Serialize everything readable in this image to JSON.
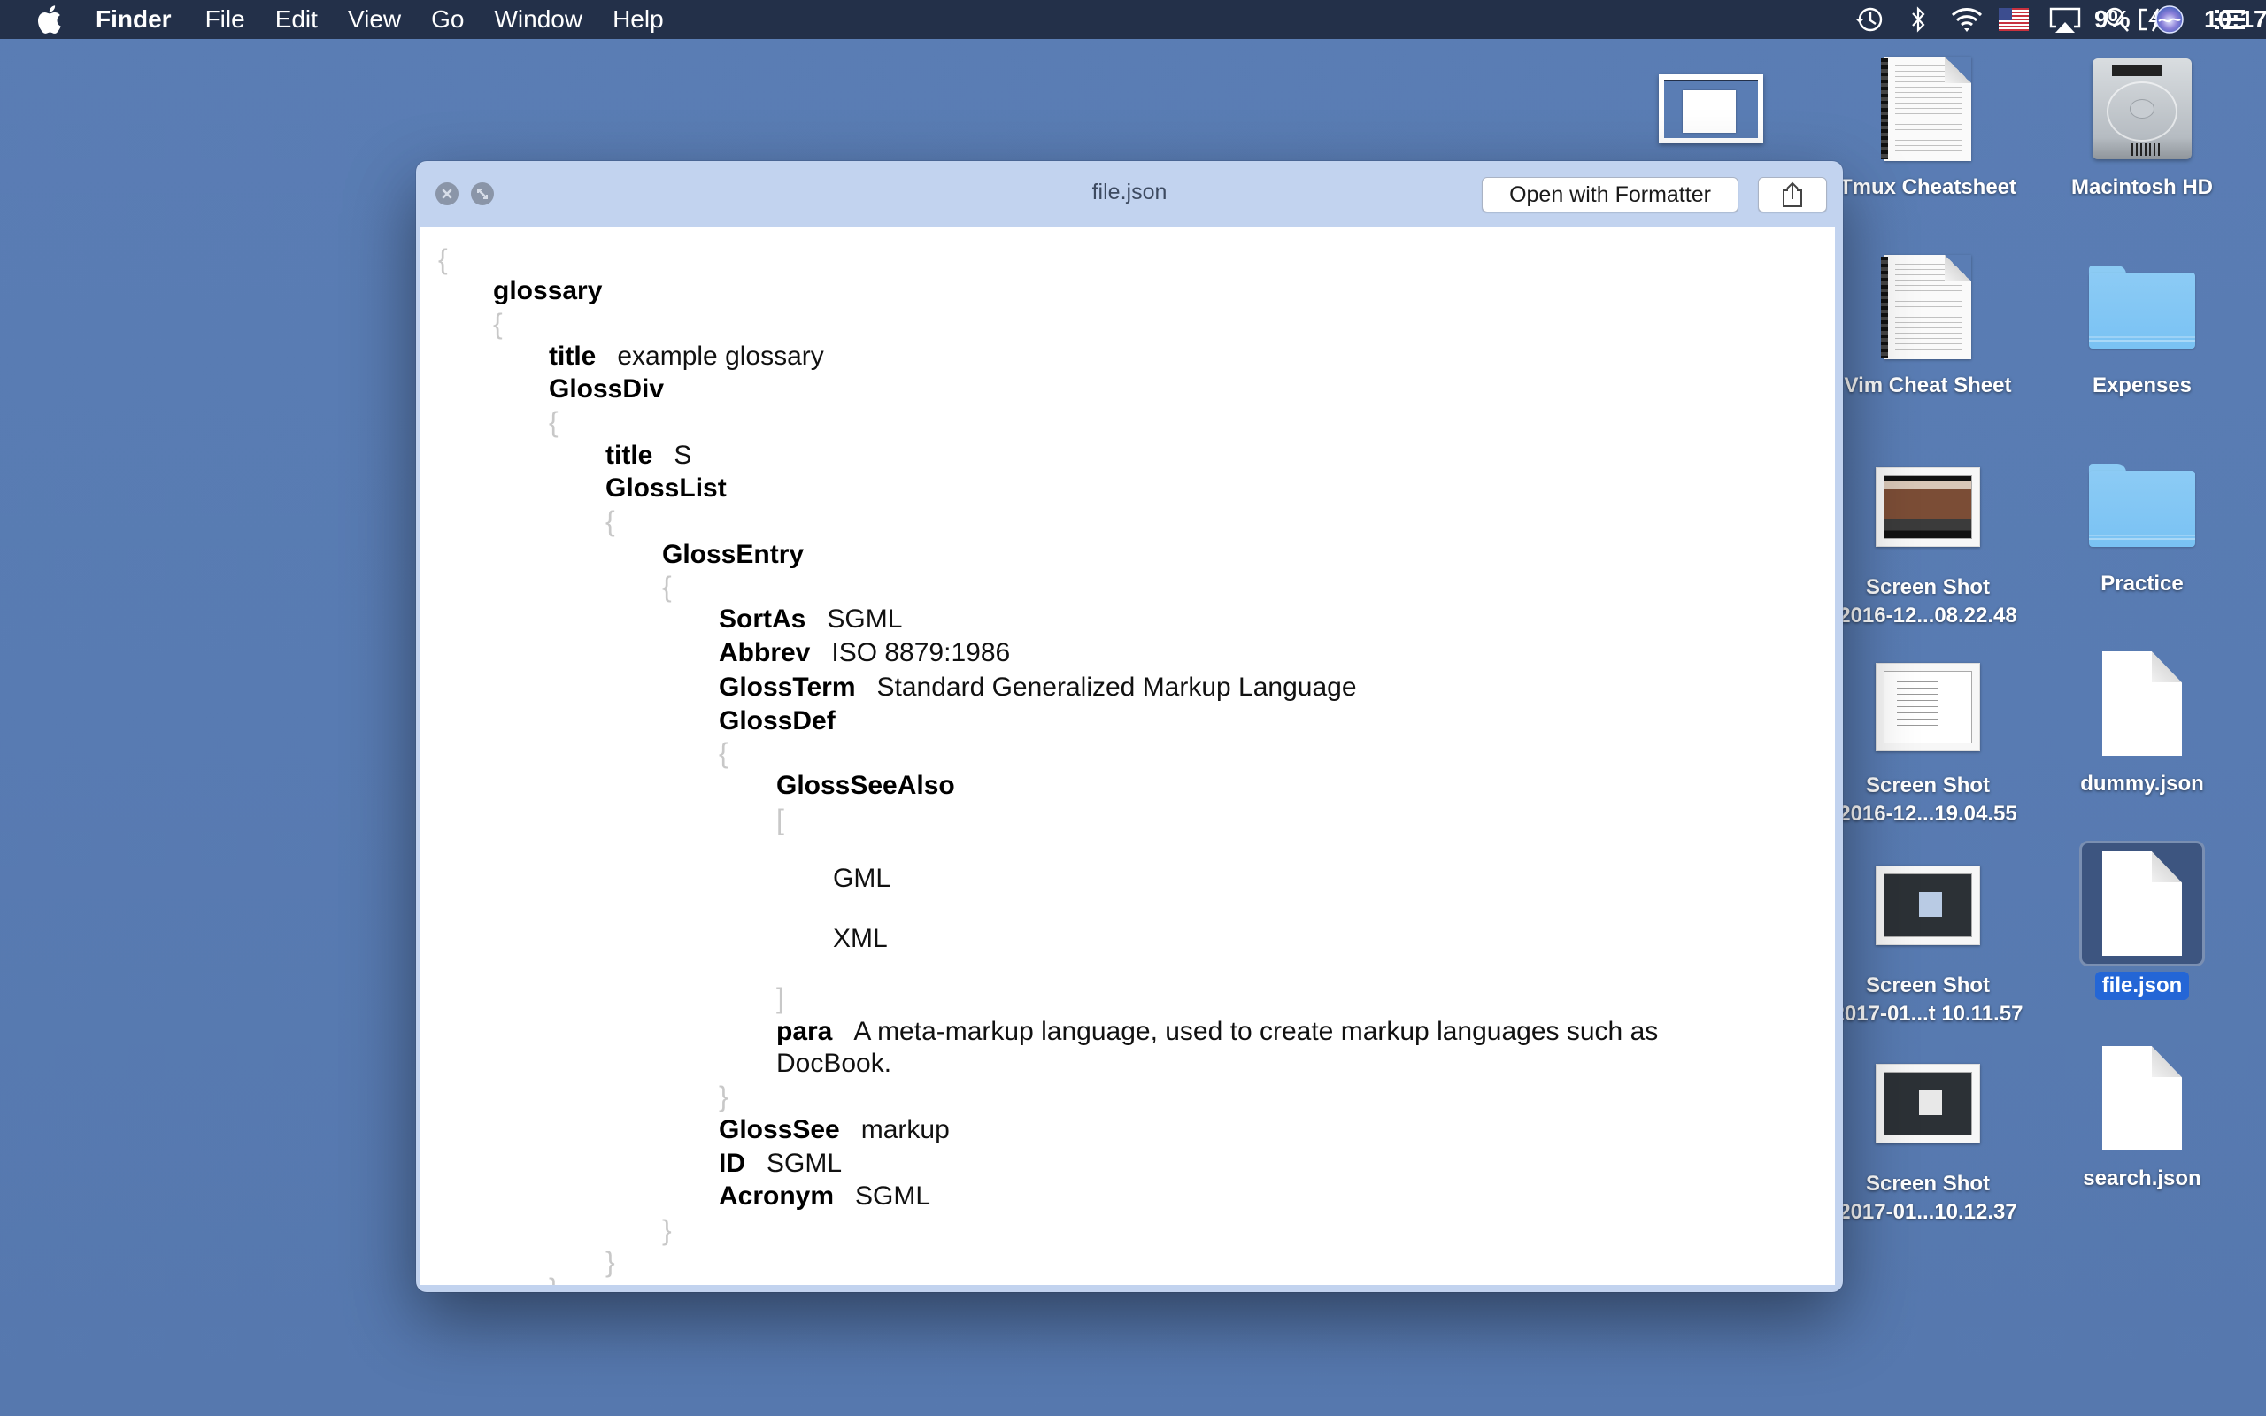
{
  "menubar": {
    "app_name": "Finder",
    "menus": [
      "File",
      "Edit",
      "View",
      "Go",
      "Window",
      "Help"
    ],
    "status": {
      "battery_percent": "9%",
      "clock": "10:17",
      "icons": [
        "time-machine-icon",
        "bluetooth-icon",
        "wifi-icon",
        "us-flag-input-icon",
        "airplay-icon",
        "battery-charging-icon",
        "spotlight-search-icon",
        "siri-icon",
        "notification-center-icon"
      ]
    }
  },
  "window": {
    "title": "file.json",
    "open_with_button": "Open with Formatter",
    "share_icon": "share-icon",
    "close_icon": "close-icon",
    "fullscreen_icon": "fullscreen-icon"
  },
  "json_view": {
    "lines": [
      {
        "type": "brace",
        "text": "{"
      },
      {
        "type": "key",
        "key": "glossary"
      },
      {
        "type": "brace",
        "text": "{"
      },
      {
        "type": "pair",
        "key": "title",
        "value": "example glossary"
      },
      {
        "type": "key",
        "key": "GlossDiv"
      },
      {
        "type": "brace",
        "text": "{"
      },
      {
        "type": "pair",
        "key": "title",
        "value": "S"
      },
      {
        "type": "key",
        "key": "GlossList"
      },
      {
        "type": "brace",
        "text": "{"
      },
      {
        "type": "key",
        "key": "GlossEntry"
      },
      {
        "type": "brace",
        "text": "{"
      },
      {
        "type": "pair",
        "key": "SortAs",
        "value": "SGML"
      },
      {
        "type": "pair",
        "key": "Abbrev",
        "value": "ISO 8879:1986"
      },
      {
        "type": "pair",
        "key": "GlossTerm",
        "value": "Standard Generalized Markup Language"
      },
      {
        "type": "key",
        "key": "GlossDef"
      },
      {
        "type": "brace",
        "text": "{"
      },
      {
        "type": "key",
        "key": "GlossSeeAlso"
      },
      {
        "type": "brace",
        "text": "["
      },
      {
        "type": "value",
        "value": "GML"
      },
      {
        "type": "value",
        "value": "XML"
      },
      {
        "type": "brace",
        "text": "]"
      },
      {
        "type": "pair",
        "key": "para",
        "value": "A meta-markup language, used to create markup languages such as DocBook."
      },
      {
        "type": "brace",
        "text": "}"
      },
      {
        "type": "pair",
        "key": "GlossSee",
        "value": "markup"
      },
      {
        "type": "pair",
        "key": "ID",
        "value": "SGML"
      },
      {
        "type": "pair",
        "key": "Acronym",
        "value": "SGML"
      },
      {
        "type": "brace",
        "text": "}"
      },
      {
        "type": "brace",
        "text": "}"
      },
      {
        "type": "brace",
        "text": "}"
      }
    ]
  },
  "desktop": {
    "icons": [
      {
        "label": "Tmux Cheatsheet",
        "kind": "cheatsheet"
      },
      {
        "label": "Macintosh HD",
        "kind": "hard-drive"
      },
      {
        "label": "Vim Cheat Sheet",
        "kind": "cheatsheet"
      },
      {
        "label": "Expenses",
        "kind": "folder"
      },
      {
        "label": "Screen Shot",
        "label2": "2016-12...08.22.48",
        "kind": "screenshot"
      },
      {
        "label": "Practice",
        "kind": "folder"
      },
      {
        "label": "Screen Shot",
        "label2": "2016-12...19.04.55",
        "kind": "screenshot"
      },
      {
        "label": "dummy.json",
        "kind": "document"
      },
      {
        "label": "Screen Shot",
        "label2": "2017-01...t 10.11.57",
        "kind": "screenshot"
      },
      {
        "label": "file.json",
        "kind": "document",
        "selected": true
      },
      {
        "label": "Screen Shot",
        "label2": "2017-01...10.12.37",
        "kind": "screenshot"
      },
      {
        "label": "search.json",
        "kind": "document"
      }
    ]
  }
}
